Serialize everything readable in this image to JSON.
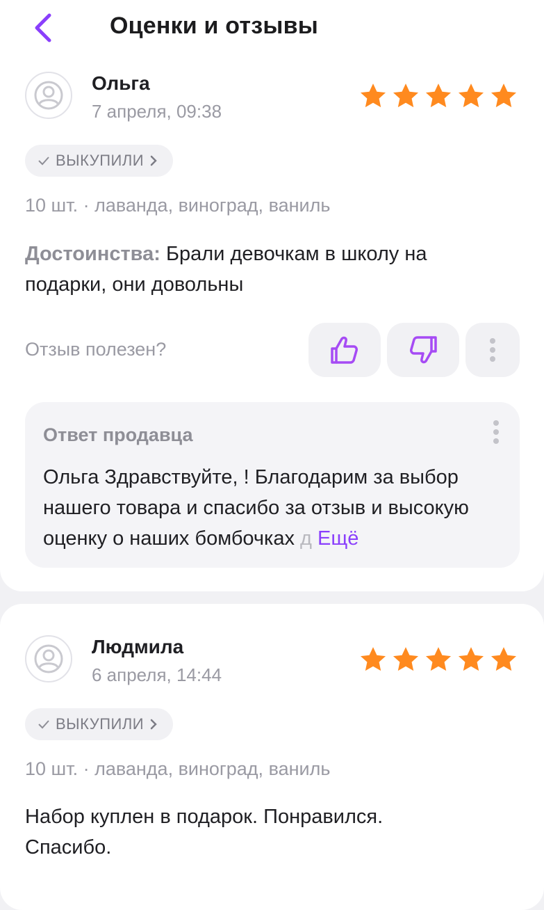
{
  "header": {
    "title": "Оценки и отзывы"
  },
  "colors": {
    "accent": "#8a3ffc",
    "star": "#ff8a1f"
  },
  "reviews": [
    {
      "author": "Ольга",
      "date": "7 апреля, 09:38",
      "rating": 5,
      "badge": "ВЫКУПИЛИ",
      "variant": "10 шт. · лаванда, виноград, ваниль",
      "pros_label": "Достоинства:",
      "text": "Брали девочкам в школу на подарки, они довольны",
      "helpful_label": "Отзыв полезен?",
      "reply": {
        "title": "Ответ продавца",
        "text": "Ольга Здравствуйте, ! Благодарим за выбор нашего товара и спасибо за отзыв и высокую оценку о наших бомбочках",
        "fade": " д",
        "more": "Ещё"
      }
    },
    {
      "author": "Людмила",
      "date": "6 апреля, 14:44",
      "rating": 5,
      "badge": "ВЫКУПИЛИ",
      "variant": "10 шт. · лаванда, виноград, ваниль",
      "text": "Набор куплен в подарок. Понравился. Спасибо."
    }
  ]
}
